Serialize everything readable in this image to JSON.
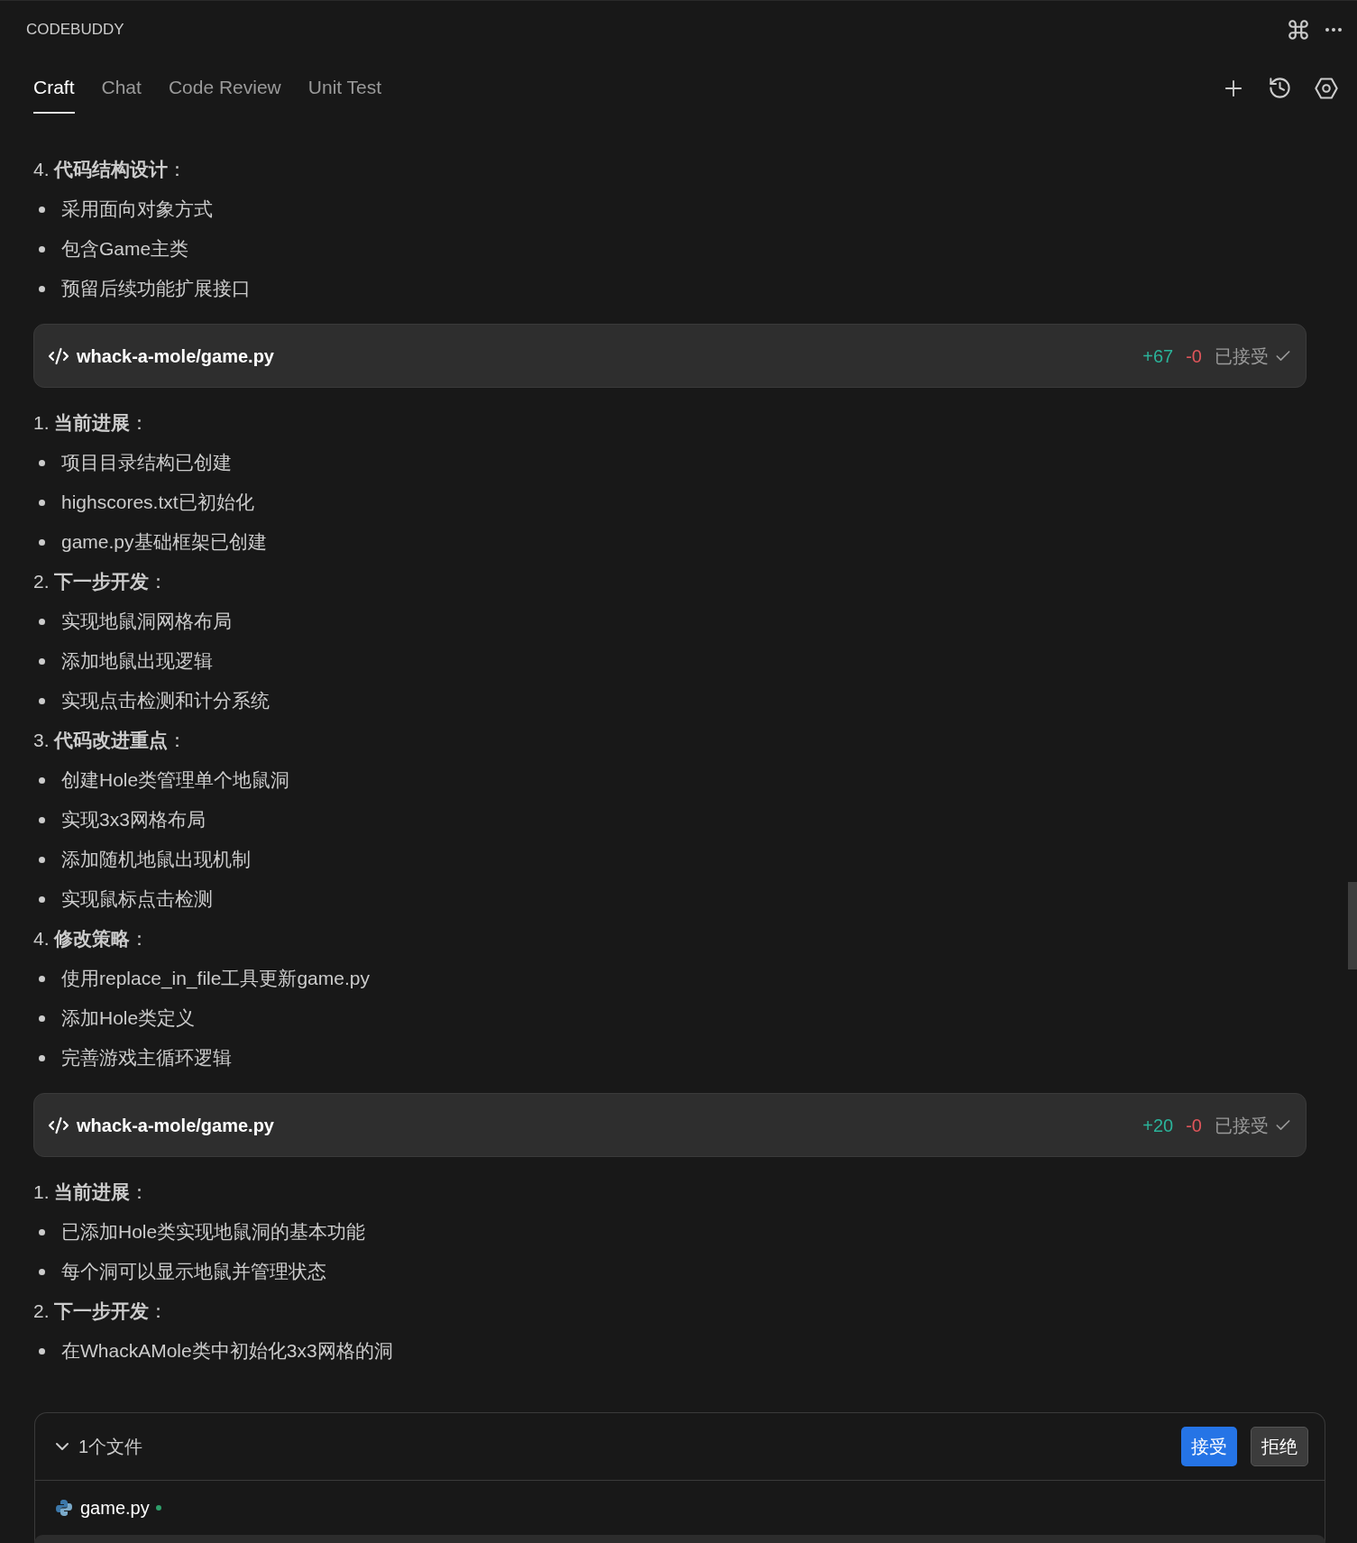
{
  "panel_title": "CODEBUDDY",
  "tabs": [
    {
      "label": "Craft",
      "selected": true
    },
    {
      "label": "Chat",
      "selected": false
    },
    {
      "label": "Code Review",
      "selected": false
    },
    {
      "label": "Unit Test",
      "selected": false
    }
  ],
  "messages": [
    {
      "kind": "heading",
      "text": "4. **代码结构设计**："
    },
    {
      "kind": "bullet",
      "text": "采用面向对象方式"
    },
    {
      "kind": "bullet",
      "text": "包含Game主类"
    },
    {
      "kind": "bullet",
      "text": "预留后续功能扩展接口"
    },
    {
      "kind": "code_block",
      "path": "whack-a-mole/game.py",
      "added": "+67",
      "removed": "-0",
      "status": "已接受"
    },
    {
      "kind": "heading",
      "text": "1. **当前进展**："
    },
    {
      "kind": "bullet",
      "text": "项目目录结构已创建"
    },
    {
      "kind": "bullet",
      "text": "highscores.txt已初始化"
    },
    {
      "kind": "bullet",
      "text": "game.py基础框架已创建"
    },
    {
      "kind": "heading",
      "text": "2. **下一步开发**："
    },
    {
      "kind": "bullet",
      "text": "实现地鼠洞网格布局"
    },
    {
      "kind": "bullet",
      "text": "添加地鼠出现逻辑"
    },
    {
      "kind": "bullet",
      "text": "实现点击检测和计分系统"
    },
    {
      "kind": "heading",
      "text": "3. **代码改进重点**："
    },
    {
      "kind": "bullet",
      "text": "创建Hole类管理单个地鼠洞"
    },
    {
      "kind": "bullet",
      "text": "实现3x3网格布局"
    },
    {
      "kind": "bullet",
      "text": "添加随机地鼠出现机制"
    },
    {
      "kind": "bullet",
      "text": "实现鼠标点击检测"
    },
    {
      "kind": "heading",
      "text": "4. **修改策略**："
    },
    {
      "kind": "bullet",
      "text": "使用replace_in_file工具更新game.py"
    },
    {
      "kind": "bullet",
      "text": "添加Hole类定义"
    },
    {
      "kind": "bullet",
      "text": "完善游戏主循环逻辑"
    },
    {
      "kind": "code_block",
      "path": "whack-a-mole/game.py",
      "added": "+20",
      "removed": "-0",
      "status": "已接受"
    },
    {
      "kind": "heading",
      "text": "1. **当前进展**："
    },
    {
      "kind": "bullet",
      "text": "已添加Hole类实现地鼠洞的基本功能"
    },
    {
      "kind": "bullet",
      "text": "每个洞可以显示地鼠并管理状态"
    },
    {
      "kind": "heading",
      "text": "2. **下一步开发**："
    },
    {
      "kind": "bullet",
      "text": "在WhackAMole类中初始化3x3网格的洞"
    }
  ],
  "changes": {
    "title": "1个文件",
    "expanded": true,
    "accept": "接受",
    "reject": "拒绝",
    "files": [
      {
        "name": "game.py",
        "modified": true
      }
    ]
  }
}
